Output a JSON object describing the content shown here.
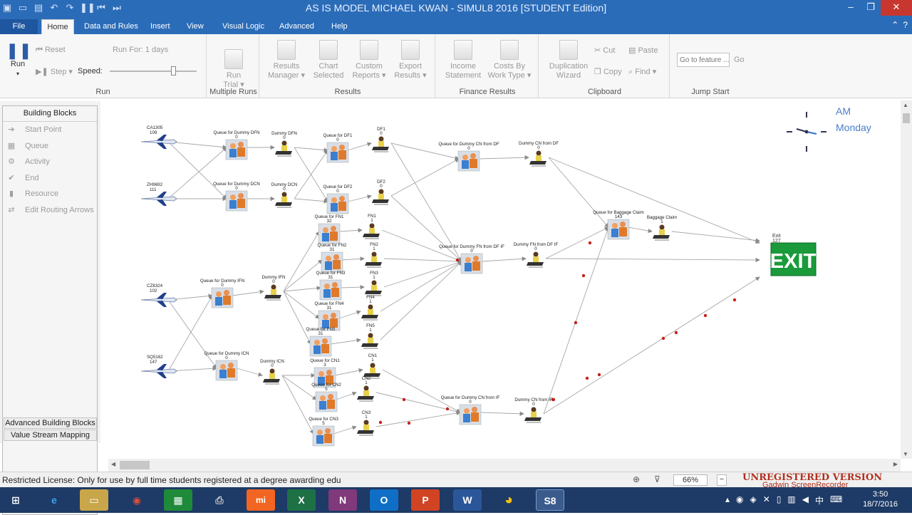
{
  "window": {
    "title": "AS IS MODEL MICHAEL KWAN - SIMUL8 2016 [STUDENT Edition]"
  },
  "tabs": [
    "File",
    "Home",
    "Data and Rules",
    "Insert",
    "View",
    "Visual Logic",
    "Advanced",
    "Help"
  ],
  "ribbon": {
    "run": {
      "run_label": "Run",
      "reset_label": "Reset",
      "step_label": "Step",
      "speed_label": "Speed:",
      "run_for": "Run For: 1 days",
      "group": "Run"
    },
    "multiple_runs": {
      "trial_label": "Run\nTrial",
      "group": "Multiple Runs"
    },
    "results": {
      "manager": "Results\nManager",
      "chart": "Chart\nSelected",
      "custom": "Custom\nReports",
      "export": "Export\nResults",
      "group": "Results"
    },
    "finance": {
      "income": "Income\nStatement",
      "costs": "Costs By\nWork Type",
      "group": "Finance Results"
    },
    "clipboard": {
      "dup": "Duplication\nWizard",
      "cut": "Cut",
      "copy": "Copy",
      "paste": "Paste",
      "find": "Find",
      "group": "Clipboard"
    },
    "jump": {
      "placeholder": "Go to feature ...",
      "go": "Go",
      "group": "Jump Start"
    }
  },
  "left_panel": {
    "header": "Building Blocks",
    "items": [
      "Start Point",
      "Queue",
      "Activity",
      "End",
      "Resource",
      "Edit Routing Arrows"
    ],
    "advanced": "Advanced Building Blocks",
    "vsm": "Value Stream Mapping"
  },
  "clock": {
    "period": "AM",
    "day": "Monday"
  },
  "model": {
    "starts": [
      {
        "name": "CA1305",
        "count": "109"
      },
      {
        "name": "ZH9692",
        "count": "111"
      },
      {
        "name": "CZ8324",
        "count": "102"
      },
      {
        "name": "SQ5162",
        "count": "147"
      }
    ],
    "queues": [
      {
        "name": "Queue for Dummy DFN",
        "count": "0"
      },
      {
        "name": "Queue for Dummy DCN",
        "count": "0"
      },
      {
        "name": "Queue for DF1",
        "count": "0"
      },
      {
        "name": "Queue for DF2",
        "count": "0"
      },
      {
        "name": "Queue for Dummy CN from DF",
        "count": "0"
      },
      {
        "name": "Queue for FN1",
        "count": "32"
      },
      {
        "name": "Queue for FN2",
        "count": "31"
      },
      {
        "name": "Queue for FN3",
        "count": "31"
      },
      {
        "name": "Queue for FN4",
        "count": "31"
      },
      {
        "name": "Queue for FN5",
        "count": "31"
      },
      {
        "name": "Queue for Dummy IFN",
        "count": "0"
      },
      {
        "name": "Queue for Dummy ICN",
        "count": "0"
      },
      {
        "name": "Queue for CN1",
        "count": "3"
      },
      {
        "name": "Queue for CN2",
        "count": "5"
      },
      {
        "name": "Queue for CN3",
        "count": "5"
      },
      {
        "name": "Queue for Dummy FN from DF IF",
        "count": "0"
      },
      {
        "name": "Queue for Dummy CN from IF",
        "count": "0"
      },
      {
        "name": "Queue for Baggage Claim",
        "count": "143"
      }
    ],
    "activities": [
      {
        "name": "Dummy DFN",
        "count": "0"
      },
      {
        "name": "Dummy DCN",
        "count": "0"
      },
      {
        "name": "DF1",
        "count": "0"
      },
      {
        "name": "DF2",
        "count": "0"
      },
      {
        "name": "Dummy CN from DF",
        "count": "0"
      },
      {
        "name": "FN1",
        "count": "1"
      },
      {
        "name": "FN2",
        "count": "1"
      },
      {
        "name": "FN3",
        "count": "1"
      },
      {
        "name": "FN4",
        "count": "1"
      },
      {
        "name": "FN5",
        "count": "1"
      },
      {
        "name": "Dummy IFN",
        "count": "0"
      },
      {
        "name": "Dummy ICN",
        "count": "0"
      },
      {
        "name": "CN1",
        "count": "1"
      },
      {
        "name": "CN2",
        "count": "1"
      },
      {
        "name": "CN3",
        "count": "1"
      },
      {
        "name": "Dummy FN from DF IF",
        "count": "0"
      },
      {
        "name": "Dummy CN from IF",
        "count": "0"
      },
      {
        "name": "Baggage Claim",
        "count": "1"
      }
    ],
    "exit": {
      "name": "Exit",
      "count": "127",
      "sign": "EXIT"
    }
  },
  "status": {
    "license": "Restricted License: Only for use by full time students registered at a degree awarding edu",
    "zoom": "66%",
    "unregistered": "UNREGISTERED VERSION",
    "recorder": "Gadwin ScreenRecorder"
  },
  "taskbar": {
    "time": "3:50",
    "date": "18/7/2016"
  },
  "colors": {
    "titlebar": "#2b6cb8",
    "exit_green": "#1a9a3a",
    "dot_red": "#c8201a"
  }
}
